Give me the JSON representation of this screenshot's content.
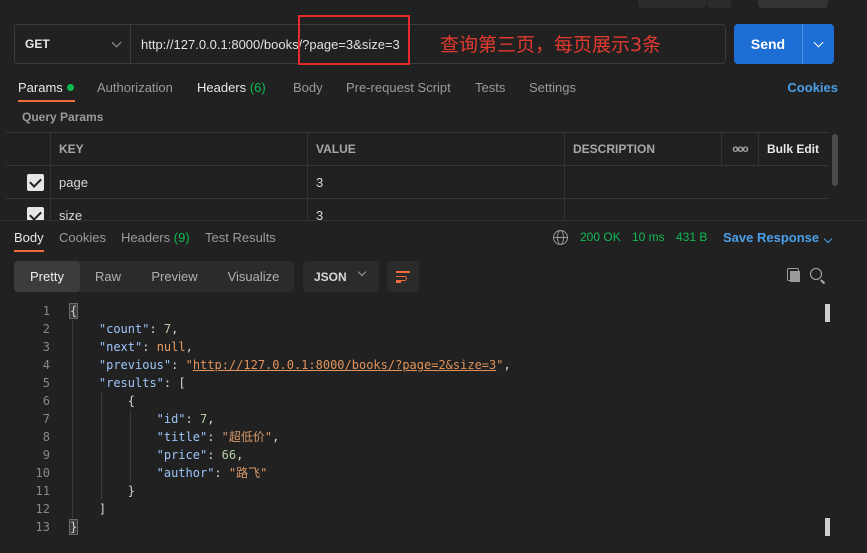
{
  "request": {
    "method": "GET",
    "url": "http://127.0.0.1:8000/books/?page=3&size=3",
    "annotation": "查询第三页，每页展示3条",
    "send_label": "Send"
  },
  "tabs": {
    "params": "Params",
    "authorization": "Authorization",
    "headers": "Headers",
    "headers_count": "(6)",
    "body": "Body",
    "prerequest": "Pre-request Script",
    "tests": "Tests",
    "settings": "Settings",
    "cookies": "Cookies"
  },
  "query_params": {
    "section_label": "Query Params",
    "headers": {
      "key": "KEY",
      "value": "VALUE",
      "description": "DESCRIPTION",
      "more": "ooo",
      "bulk_edit": "Bulk Edit"
    },
    "rows": [
      {
        "key": "page",
        "value": "3",
        "checked": true
      },
      {
        "key": "size",
        "value": "3",
        "checked": true
      }
    ]
  },
  "response": {
    "tabs": {
      "body": "Body",
      "cookies": "Cookies",
      "headers": "Headers",
      "headers_count": "(9)",
      "test_results": "Test Results"
    },
    "status": "200 OK",
    "time": "10 ms",
    "size": "431 B",
    "save_label": "Save Response",
    "views": {
      "pretty": "Pretty",
      "raw": "Raw",
      "preview": "Preview",
      "visualize": "Visualize"
    },
    "format": "JSON",
    "lines": [
      {
        "n": "1",
        "t": "{"
      },
      {
        "n": "2",
        "k": "\"count\"",
        "v": "7",
        "vt": "num",
        "c": ","
      },
      {
        "n": "3",
        "k": "\"next\"",
        "v": "null",
        "vt": "kw",
        "c": ","
      },
      {
        "n": "4",
        "k": "\"previous\"",
        "v": "\"http://127.0.0.1:8000/books/?page=2&size=3\"",
        "vt": "url",
        "c": ","
      },
      {
        "n": "5",
        "k": "\"results\"",
        "v": "[",
        "vt": "p",
        "c": ""
      },
      {
        "n": "6",
        "t": "{"
      },
      {
        "n": "7",
        "k": "\"id\"",
        "v": "7",
        "vt": "num",
        "c": ","
      },
      {
        "n": "8",
        "k": "\"title\"",
        "v": "\"超低价\"",
        "vt": "str",
        "c": ","
      },
      {
        "n": "9",
        "k": "\"price\"",
        "v": "66",
        "vt": "num",
        "c": ","
      },
      {
        "n": "10",
        "k": "\"author\"",
        "v": "\"路飞\"",
        "vt": "str",
        "c": ""
      },
      {
        "n": "11",
        "t": "}"
      },
      {
        "n": "12",
        "t": "]"
      },
      {
        "n": "13",
        "t": "}"
      }
    ]
  }
}
